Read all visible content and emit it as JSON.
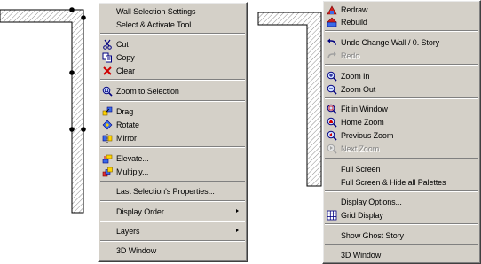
{
  "left_menu": {
    "items": [
      {
        "label": "Wall Selection Settings",
        "icon": null,
        "enabled": true
      },
      {
        "label": "Select & Activate Tool",
        "icon": null,
        "enabled": true
      },
      {
        "label": "Cut",
        "icon": "scissors-icon",
        "enabled": true
      },
      {
        "label": "Copy",
        "icon": "copy-icon",
        "enabled": true
      },
      {
        "label": "Clear",
        "icon": "clear-x-icon",
        "enabled": true
      },
      {
        "label": "Zoom to Selection",
        "icon": "zoom-to-selection-icon",
        "enabled": true
      },
      {
        "label": "Drag",
        "icon": "drag-icon",
        "enabled": true
      },
      {
        "label": "Rotate",
        "icon": "rotate-icon",
        "enabled": true
      },
      {
        "label": "Mirror",
        "icon": "mirror-icon",
        "enabled": true
      },
      {
        "label": "Elevate...",
        "icon": "elevate-icon",
        "enabled": true
      },
      {
        "label": "Multiply...",
        "icon": "multiply-icon",
        "enabled": true
      },
      {
        "label": "Last Selection's Properties...",
        "icon": null,
        "enabled": true
      },
      {
        "label": "Display Order",
        "icon": null,
        "enabled": true,
        "submenu": true
      },
      {
        "label": "Layers",
        "icon": null,
        "enabled": true,
        "submenu": true
      },
      {
        "label": "3D Window",
        "icon": null,
        "enabled": true
      }
    ]
  },
  "right_menu": {
    "items": [
      {
        "label": "Redraw",
        "icon": "redraw-icon",
        "enabled": true
      },
      {
        "label": "Rebuild",
        "icon": "rebuild-icon",
        "enabled": true
      },
      {
        "label": "Undo Change Wall / 0. Story",
        "icon": "undo-icon",
        "enabled": true
      },
      {
        "label": "Redo",
        "icon": "redo-icon",
        "enabled": false
      },
      {
        "label": "Zoom In",
        "icon": "zoom-in-icon",
        "enabled": true
      },
      {
        "label": "Zoom Out",
        "icon": "zoom-out-icon",
        "enabled": true
      },
      {
        "label": "Fit in Window",
        "icon": "fit-in-window-icon",
        "enabled": true
      },
      {
        "label": "Home Zoom",
        "icon": "home-zoom-icon",
        "enabled": true
      },
      {
        "label": "Previous Zoom",
        "icon": "previous-zoom-icon",
        "enabled": true
      },
      {
        "label": "Next Zoom",
        "icon": "next-zoom-icon",
        "enabled": false
      },
      {
        "label": "Full Screen",
        "icon": null,
        "enabled": true
      },
      {
        "label": "Full Screen & Hide all Palettes",
        "icon": null,
        "enabled": true
      },
      {
        "label": "Display Options...",
        "icon": null,
        "enabled": true
      },
      {
        "label": "Grid Display",
        "icon": "grid-display-icon",
        "enabled": true
      },
      {
        "label": "Show Ghost Story",
        "icon": null,
        "enabled": true
      },
      {
        "label": "3D Window",
        "icon": null,
        "enabled": true
      }
    ]
  },
  "colors": {
    "menu_bg": "#d4d0c8",
    "hatch": "#8c8c8c",
    "wall_outline": "#000000",
    "disabled_text": "#808080"
  }
}
